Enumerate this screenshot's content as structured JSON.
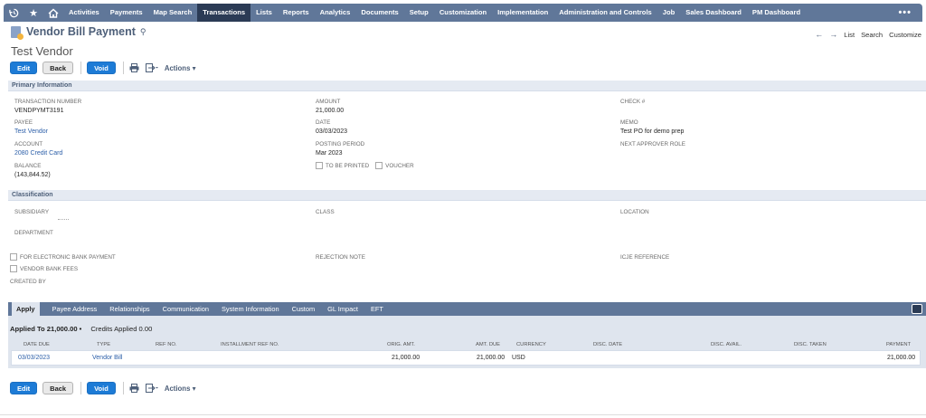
{
  "nav": {
    "items": [
      "Activities",
      "Payments",
      "Map Search",
      "Transactions",
      "Lists",
      "Reports",
      "Analytics",
      "Documents",
      "Setup",
      "Customization",
      "Implementation",
      "Administration and Controls",
      "Job",
      "Sales Dashboard",
      "PM Dashboard"
    ],
    "active": "Transactions",
    "more": "•••"
  },
  "header": {
    "record_type": "Vendor Bill Payment",
    "record_name": "Test Vendor",
    "links": {
      "list": "List",
      "search": "Search",
      "customize": "Customize"
    }
  },
  "buttons": {
    "edit": "Edit",
    "back": "Back",
    "void": "Void",
    "actions": "Actions"
  },
  "primary": {
    "title": "Primary Information",
    "transaction_number": {
      "label": "TRANSACTION NUMBER",
      "value": "VENDPYMT3191"
    },
    "payee": {
      "label": "PAYEE",
      "value": "Test Vendor"
    },
    "account": {
      "label": "ACCOUNT",
      "value": "2080 Credit Card"
    },
    "balance": {
      "label": "BALANCE",
      "value": "(143,844.52)"
    },
    "amount": {
      "label": "AMOUNT",
      "value": "21,000.00"
    },
    "date": {
      "label": "DATE",
      "value": "03/03/2023"
    },
    "posting_period": {
      "label": "POSTING PERIOD",
      "value": "Mar 2023"
    },
    "to_be_printed": "TO BE PRINTED",
    "voucher": "VOUCHER",
    "check": {
      "label": "CHECK #"
    },
    "memo": {
      "label": "MEMO",
      "value": "Test PO for demo prep"
    },
    "next_approver": {
      "label": "NEXT APPROVER ROLE"
    }
  },
  "classification": {
    "title": "Classification",
    "subsidiary": "SUBSIDIARY",
    "class": "CLASS",
    "location": "LOCATION",
    "department": "DEPARTMENT",
    "electronic_bank_payment": "FOR ELECTRONIC BANK PAYMENT",
    "vendor_bank_fees": "VENDOR BANK FEES",
    "created_by": "CREATED BY",
    "rejection_note": "REJECTION NOTE",
    "icje_reference": "ICJE REFERENCE"
  },
  "subtabs": [
    "Apply",
    "Payee Address",
    "Relationships",
    "Communication",
    "System Information",
    "Custom",
    "GL Impact",
    "EFT"
  ],
  "apply": {
    "applied_to": "Applied To 21,000.00",
    "credits_applied": "Credits Applied 0.00",
    "columns": [
      "DATE DUE",
      "TYPE",
      "REF NO.",
      "INSTALLMENT REF NO.",
      "ORIG. AMT.",
      "AMT. DUE",
      "CURRENCY",
      "DISC. DATE",
      "DISC. AVAIL.",
      "DISC. TAKEN",
      "PAYMENT"
    ],
    "rows": [
      {
        "date_due": "03/03/2023",
        "type": "Vendor Bill",
        "orig_amt": "21,000.00",
        "amt_due": "21,000.00",
        "currency": "USD",
        "payment": "21,000.00"
      }
    ]
  }
}
